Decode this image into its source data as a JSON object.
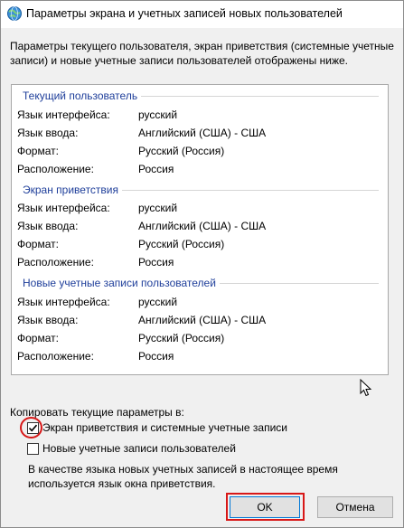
{
  "window": {
    "title": "Параметры экрана и учетных записей новых пользователей"
  },
  "intro": "Параметры текущего пользователя, экран приветствия (системные учетные записи) и новые учетные записи пользователей отображены ниже.",
  "groups": [
    {
      "title": "Текущий пользователь",
      "rows": [
        {
          "label": "Язык интерфейса:",
          "value": "русский"
        },
        {
          "label": "Язык ввода:",
          "value": "Английский (США) - США"
        },
        {
          "label": "Формат:",
          "value": "Русский (Россия)"
        },
        {
          "label": "Расположение:",
          "value": "Россия"
        }
      ]
    },
    {
      "title": "Экран приветствия",
      "rows": [
        {
          "label": "Язык интерфейса:",
          "value": "русский"
        },
        {
          "label": "Язык ввода:",
          "value": "Английский (США) - США"
        },
        {
          "label": "Формат:",
          "value": "Русский (Россия)"
        },
        {
          "label": "Расположение:",
          "value": "Россия"
        }
      ]
    },
    {
      "title": "Новые учетные записи пользователей",
      "rows": [
        {
          "label": "Язык интерфейса:",
          "value": "русский"
        },
        {
          "label": "Язык ввода:",
          "value": "Английский (США) - США"
        },
        {
          "label": "Формат:",
          "value": "Русский (Россия)"
        },
        {
          "label": "Расположение:",
          "value": "Россия"
        }
      ]
    }
  ],
  "copy": {
    "label": "Копировать текущие параметры в:",
    "welcome_checkbox": {
      "label": "Экран приветствия и системные учетные записи",
      "checked": true
    },
    "new_users_checkbox": {
      "label": "Новые учетные записи пользователей",
      "checked": false
    }
  },
  "note": "В качестве языка новых учетных записей в настоящее время используется язык окна приветствия.",
  "buttons": {
    "ok": "OK",
    "cancel": "Отмена"
  },
  "colors": {
    "group_title": "#1e3e9a",
    "highlight": "#d81818"
  },
  "icons": {
    "title": "globe-settings-icon",
    "cursor": "mouse-pointer-icon"
  }
}
